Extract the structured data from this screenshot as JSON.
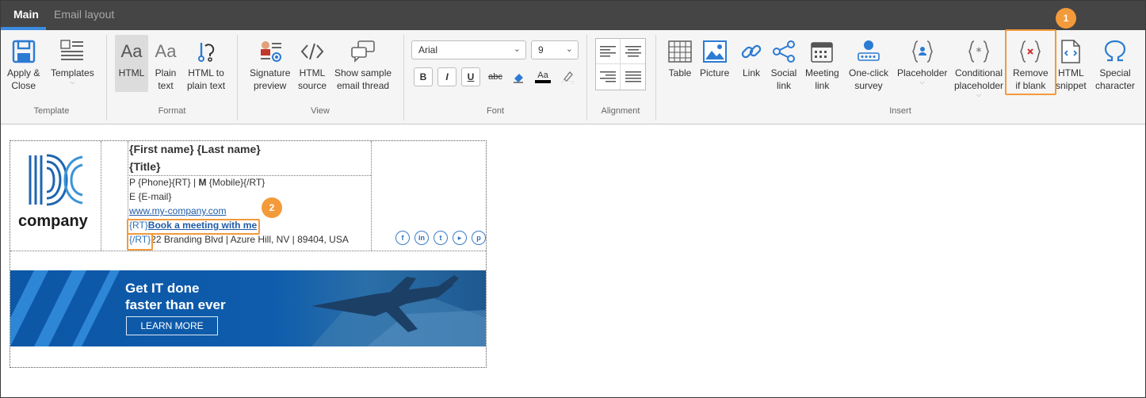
{
  "tabs": {
    "main": "Main",
    "email_layout": "Email layout"
  },
  "groups": {
    "template": "Template",
    "format": "Format",
    "view": "View",
    "font": "Font",
    "alignment": "Alignment",
    "insert": "Insert"
  },
  "template_group": {
    "apply_close": [
      "Apply &",
      "Close"
    ],
    "templates": "Templates"
  },
  "format_group": {
    "html": "HTML",
    "plain_text": [
      "Plain",
      "text"
    ],
    "html_to_plain": [
      "HTML to",
      "plain text"
    ]
  },
  "view_group": {
    "signature_preview": [
      "Signature",
      "preview"
    ],
    "html_source": [
      "HTML",
      "source"
    ],
    "sample_thread": [
      "Show sample",
      "email thread"
    ]
  },
  "font_group": {
    "font_family": "Arial",
    "font_size": "9",
    "bold": "B",
    "italic": "I",
    "underline": "U",
    "strikethrough": "abc",
    "font_color": "Aa"
  },
  "insert_group": {
    "table": "Table",
    "picture": "Picture",
    "link": "Link",
    "social_link": [
      "Social",
      "link"
    ],
    "meeting_link": [
      "Meeting",
      "link"
    ],
    "survey": [
      "One-click",
      "survey"
    ],
    "placeholder": "Placeholder",
    "conditional_placeholder": [
      "Conditional",
      "placeholder"
    ],
    "remove_if_blank": [
      "Remove",
      "if blank"
    ],
    "html_snippet": [
      "HTML",
      "snippet"
    ],
    "special_character": [
      "Special",
      "character"
    ]
  },
  "badges": {
    "one": "1",
    "two": "2"
  },
  "signature": {
    "company_name": "company",
    "name_line": "{First name} {Last name}",
    "title_line": "{Title}",
    "phone_prefix": "P ",
    "phone_value": "{Phone}{RT}",
    "phone_sep": " | ",
    "mobile_label": "M",
    "mobile_value": " {Mobile}{/RT}",
    "email_line": "E {E-mail}",
    "website": "www.my-company.com",
    "rt_open": "{RT}",
    "meeting_link": "Book a meeting with me",
    "rt_close": "{/RT}",
    "address": "22 Branding Blvd | Azure Hill, NV | 89404, USA"
  },
  "banner": {
    "headline": "Get IT done\nfaster than ever",
    "button": "LEARN MORE"
  },
  "colors": {
    "accent": "#f39a3b",
    "brand_blue": "#0f5cac",
    "tabbar": "#454545"
  }
}
